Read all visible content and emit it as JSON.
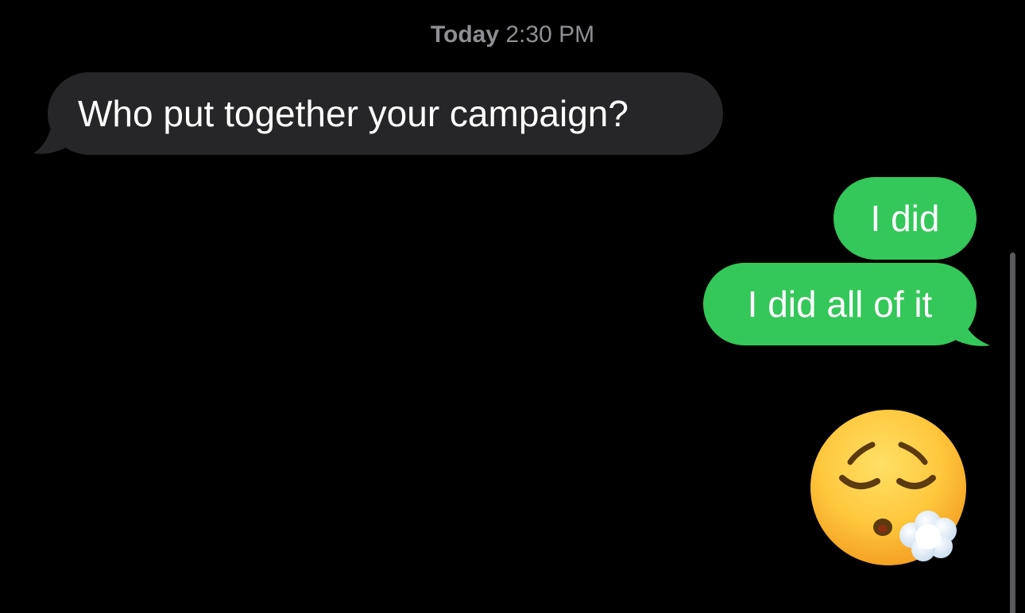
{
  "conversation": {
    "timestamp": {
      "day": "Today",
      "time": "2:30 PM"
    },
    "messages": [
      {
        "direction": "incoming",
        "text": "Who put together your campaign?"
      },
      {
        "direction": "outgoing",
        "text": "I did"
      },
      {
        "direction": "outgoing",
        "text": "I did all of it"
      },
      {
        "direction": "outgoing",
        "type": "emoji",
        "icon": "face-exhaling-emoji"
      }
    ]
  },
  "colors": {
    "background": "#000000",
    "incoming_bubble": "#262628",
    "outgoing_bubble": "#34c759",
    "timestamp_text": "#8e8e93",
    "bubble_text": "#ffffff"
  }
}
